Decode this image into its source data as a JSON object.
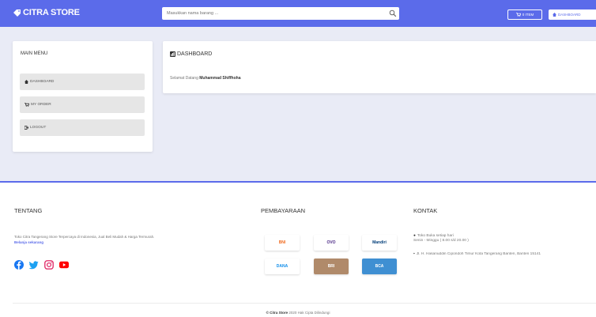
{
  "navbar": {
    "brand": "CITRA STORE",
    "search_placeholder": "Masukkan nama barang ...",
    "cart_label": "0 ITEM",
    "user_label": "DASHBOARD"
  },
  "sidebar": {
    "title": "MAIN MENU",
    "items": [
      {
        "label": "DASHBOARD",
        "icon": "home-icon"
      },
      {
        "label": "MY ORDER",
        "icon": "cart-icon"
      },
      {
        "label": "LOGOUT",
        "icon": "logout-icon"
      }
    ]
  },
  "dashboard": {
    "title": "DASHBOARD",
    "greeting_prefix": "Selamat Datang",
    "user_name": "Muhammad Shiffhoha"
  },
  "footer": {
    "about": {
      "title": "TENTANG",
      "text": "Toko Citra Tangerang Store Terpercaya di Indonesia, Jual Beli Mudah & Harga Termurah.",
      "link": "Belanja sekarang"
    },
    "socials": [
      "facebook-icon",
      "twitter-icon",
      "instagram-icon",
      "youtube-icon"
    ],
    "payment": {
      "title": "PEMBAYARAAN",
      "methods": [
        "BNI",
        "OVO",
        "Mandiri",
        "DANA",
        "BRI",
        "BCA"
      ]
    },
    "contact": {
      "title": "KONTAK",
      "hours_title": "Toko Buka setiap hari",
      "hours": "Senin - Minggu ( 8.00 s/d 20.00 )",
      "address": "Jl. H. Hasanuddin Cipondoh Timur Kota Tangerang Banten, Banten 15141"
    },
    "copyright_brand": "© Citra Store",
    "copyright_text": "2020 Hak Cipta Dilindungi"
  },
  "colors": {
    "primary": "#5b6bea",
    "content_bg": "#e9ebf6",
    "menu_item_bg": "#e6e6e6"
  }
}
